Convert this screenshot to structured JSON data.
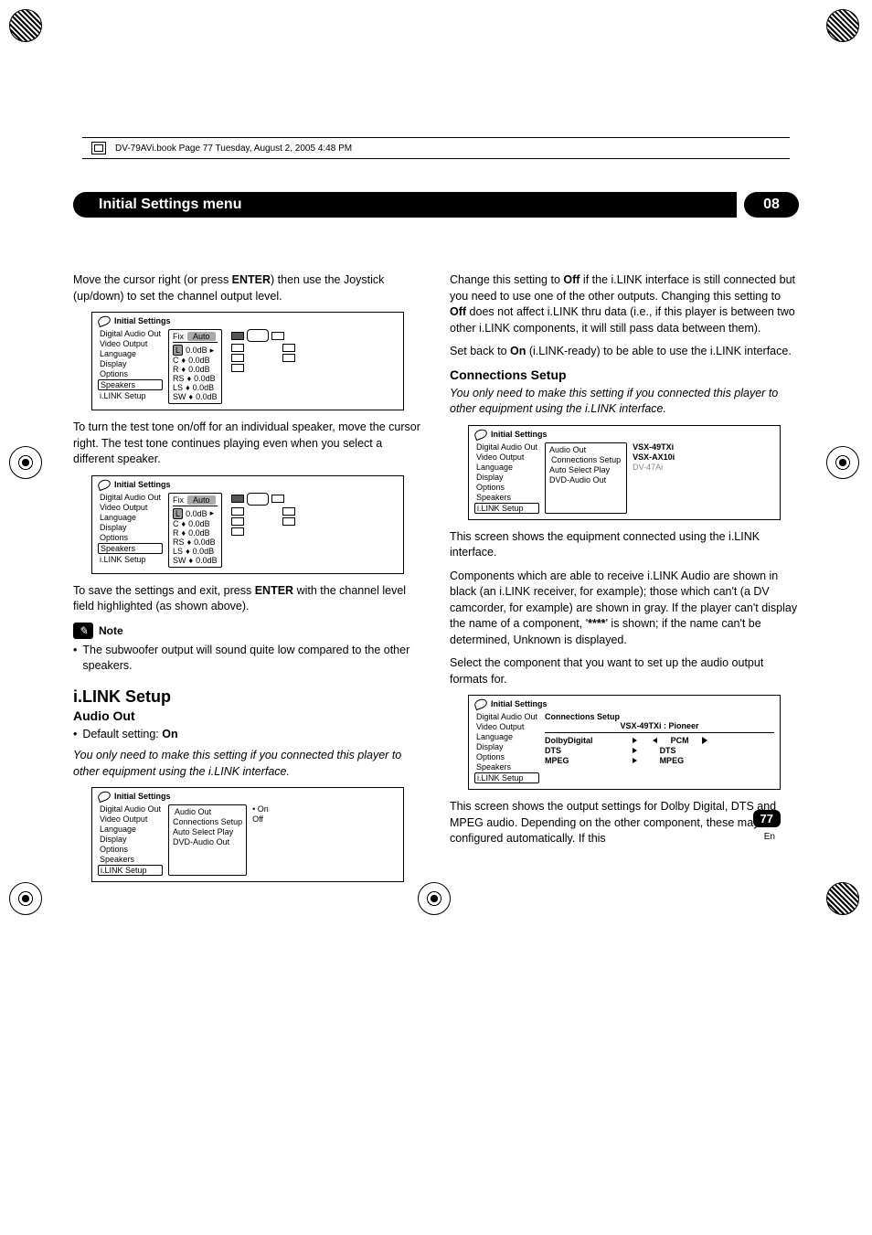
{
  "print_header": "DV-79AVi.book  Page 77  Tuesday, August 2, 2005  4:48 PM",
  "titlebar": {
    "title": "Initial Settings menu",
    "chapter": "08"
  },
  "left": {
    "p1a": "Move the cursor right (or press ",
    "p1b": "ENTER",
    "p1c": ") then use the Joystick (up/down) to set the channel output level.",
    "p2": "To turn the test tone on/off for an individual speaker, move the cursor right. The test tone continues playing even when you select a different speaker.",
    "p3a": "To save the settings and exit, press ",
    "p3b": "ENTER",
    "p3c": " with the channel level field highlighted (as shown above).",
    "note_label": "Note",
    "note_bullet": "The subwoofer output will sound quite low compared to the other speakers.",
    "h2": "i.LINK Setup",
    "h3": "Audio Out",
    "default_a": "Default setting: ",
    "default_b": "On",
    "italic_p": "You only need to make this setting if you connected this player to other equipment using the i.LINK interface."
  },
  "right": {
    "p1a": "Change this setting to ",
    "p1b": "Off",
    "p1c": " if the i.LINK interface is still connected but you need to use one of the other outputs. Changing this setting to ",
    "p1d": "Off",
    "p1e": " does not affect i.LINK thru data (i.e., if this player is between two other i.LINK components, it will still pass data between them).",
    "p2a": "Set back to ",
    "p2b": "On",
    "p2c": " (i.LINK-ready) to be able to use the i.LINK interface.",
    "h3": "Connections Setup",
    "italic_p": "You only need to make this setting if you connected this player to other equipment using the i.LINK interface.",
    "p3": "This screen shows the equipment connected using the i.LINK interface.",
    "p4a": "Components which are able to receive ",
    "p4b": "i.LINK Audio are shown in black (an i.LINK receiver, for example); those which can't (a DV camcorder, for example) are shown in gray. If the player can't display the name of a component, '",
    "p4c": "****",
    "p4d": "' is shown; if the name can't be determined, Unknown is displayed.",
    "p5": "Select the component that you want to set up the audio output formats for.",
    "p6": "This screen shows the output settings for Dolby Digital, DTS and MPEG audio. Depending on the other component, these may be configured automatically. If this"
  },
  "osd_common": {
    "title": "Initial Settings",
    "menu": [
      "Digital Audio Out",
      "Video Output",
      "Language",
      "Display",
      "Options",
      "Speakers",
      "i.LINK Setup"
    ],
    "fix": "Fix",
    "auto": "Auto",
    "channels": [
      "L",
      "C",
      "R",
      "RS",
      "LS",
      "SW"
    ],
    "val": "0.0dB"
  },
  "osd3": {
    "sub": [
      "Audio Out",
      "Connections Setup",
      "Auto Select Play",
      "DVD-Audio Out"
    ],
    "opts": [
      "On",
      "Off"
    ]
  },
  "osd4": {
    "sub": [
      "Audio Out",
      "Connections Setup",
      "Auto Select Play",
      "DVD-Audio Out"
    ],
    "devices": [
      "VSX-49TXi",
      "VSX-AX10i",
      "DV-47Ai"
    ]
  },
  "osd5": {
    "header": "Connections Setup",
    "device": "VSX-49TXi : Pioneer",
    "rows": [
      {
        "l": "DolbyDigital",
        "r": "PCM"
      },
      {
        "l": "DTS",
        "r": "DTS"
      },
      {
        "l": "MPEG",
        "r": "MPEG"
      }
    ]
  },
  "page_number": "77",
  "page_lang": "En"
}
